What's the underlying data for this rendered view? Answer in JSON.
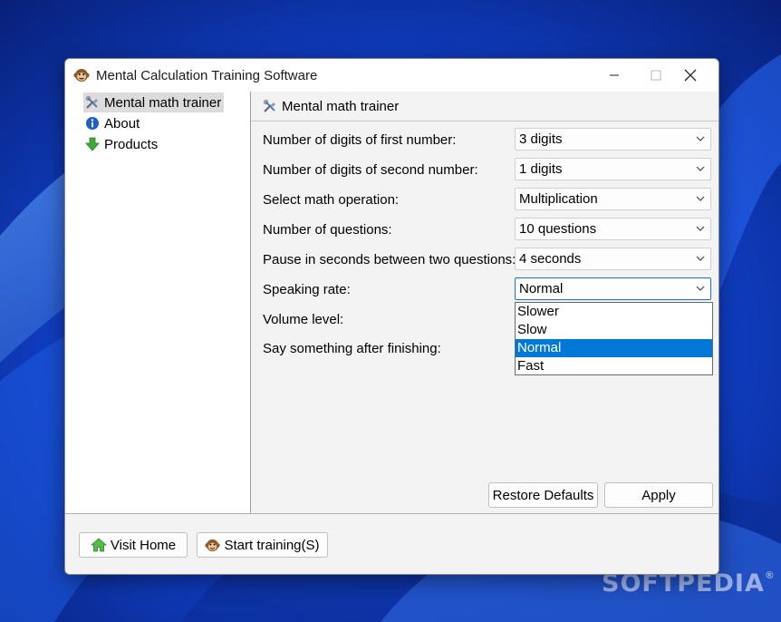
{
  "window": {
    "title": "Mental Calculation Training Software"
  },
  "sidebar": {
    "items": [
      {
        "label": "Mental math trainer",
        "selected": true,
        "icon": "tools-icon"
      },
      {
        "label": "About",
        "selected": false,
        "icon": "info-icon"
      },
      {
        "label": "Products",
        "selected": false,
        "icon": "download-arrow-icon"
      }
    ]
  },
  "panel": {
    "title": "Mental math trainer",
    "settings": [
      {
        "label": "Number of digits of first number:",
        "value": "3 digits"
      },
      {
        "label": "Number of digits of second number:",
        "value": "1 digits"
      },
      {
        "label": "Select math operation:",
        "value": "Multiplication"
      },
      {
        "label": "Number of questions:",
        "value": "10 questions"
      },
      {
        "label": "Pause in seconds between two questions:",
        "value": "4 seconds"
      },
      {
        "label": "Speaking rate:",
        "value": "Normal"
      },
      {
        "label": "Volume level:"
      },
      {
        "label": "Say something after finishing:"
      }
    ],
    "dropdown_options": [
      "Slower",
      "Slow",
      "Normal",
      "Fast"
    ],
    "dropdown_selected": "Normal",
    "restore_label": "Restore Defaults",
    "apply_label": "Apply"
  },
  "footer": {
    "visit_home_label": "Visit Home",
    "start_training_label": "Start training(S)"
  },
  "watermark": {
    "text": "SOFTPEDIA",
    "mark": "®"
  },
  "colors": {
    "accent": "#0078d7",
    "wallpaper": "#0a2a9e"
  }
}
